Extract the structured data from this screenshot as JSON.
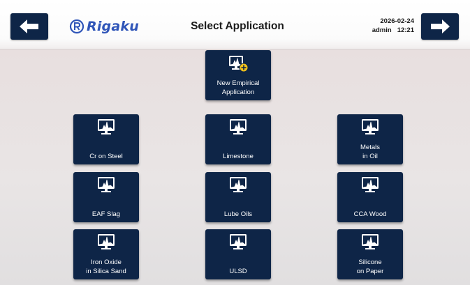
{
  "header": {
    "logo_text": "Rigaku",
    "title": "Select Application",
    "date": "2026-02-24",
    "user": "admin",
    "time": "12:21",
    "back_icon": "arrow-left-icon",
    "forward_icon": "arrow-right-icon"
  },
  "new_application": {
    "label": "New Empirical\nApplication",
    "icon": "monitor-add-icon"
  },
  "applications": [
    {
      "label": "Cr on Steel"
    },
    {
      "label": "Limestone"
    },
    {
      "label": "Metals\nin Oil"
    },
    {
      "label": "EAF Slag"
    },
    {
      "label": "Lube Oils"
    },
    {
      "label": "CCA Wood"
    },
    {
      "label": "Iron Oxide\nin Silica Sand"
    },
    {
      "label": "ULSD"
    },
    {
      "label": "Silicone\non Paper"
    }
  ],
  "colors": {
    "tile": "#0e2547",
    "brand_blue": "#2f55b8",
    "add_badge": "#f2c21b"
  }
}
